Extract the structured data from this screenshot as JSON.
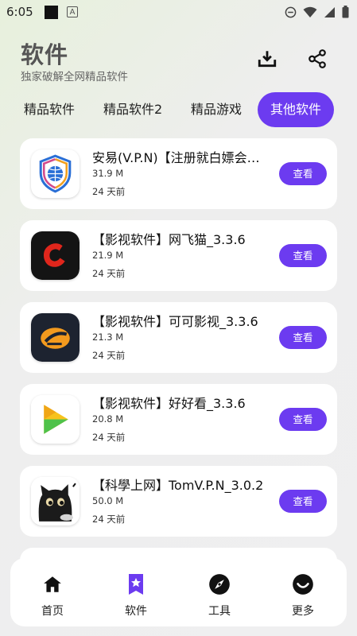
{
  "status_bar": {
    "time": "6:05"
  },
  "header": {
    "title": "软件",
    "subtitle": "独家破解全网精品软件"
  },
  "tabs": [
    {
      "label": "精品软件",
      "active": false
    },
    {
      "label": "精品软件2",
      "active": false
    },
    {
      "label": "精品游戏",
      "active": false
    },
    {
      "label": "其他软件",
      "active": true
    }
  ],
  "apps": [
    {
      "title": "安易(V.P.N)【注册就白嫖会员】",
      "size": "31.9 M",
      "time": "24 天前",
      "button": "查看",
      "icon": "shield-globe-icon"
    },
    {
      "title": "【影视软件】网飞猫_3.3.6",
      "size": "21.9 M",
      "time": "24 天前",
      "button": "查看",
      "icon": "netcat-logo-icon"
    },
    {
      "title": "【影视软件】可可影视_3.3.6",
      "size": "21.3 M",
      "time": "24 天前",
      "button": "查看",
      "icon": "keke-logo-icon"
    },
    {
      "title": "【影视软件】好好看_3.3.6",
      "size": "20.8 M",
      "time": "24 天前",
      "button": "查看",
      "icon": "play-logo-icon"
    },
    {
      "title": "【科學上网】TomV.P.N_3.0.2",
      "size": "50.0 M",
      "time": "24 天前",
      "button": "查看",
      "icon": "black-cat-icon"
    }
  ],
  "bottom_nav": [
    {
      "label": "首页",
      "icon": "home-icon",
      "active": false
    },
    {
      "label": "软件",
      "icon": "bookmark-star-icon",
      "active": true
    },
    {
      "label": "工具",
      "icon": "compass-icon",
      "active": false
    },
    {
      "label": "更多",
      "icon": "smile-icon",
      "active": false
    }
  ],
  "colors": {
    "accent": "#6c3bf0",
    "card": "#ffffff"
  }
}
